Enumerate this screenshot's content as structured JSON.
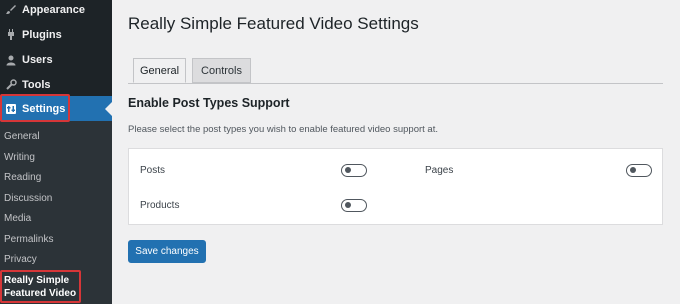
{
  "sidebar": {
    "menu": [
      {
        "label": "Appearance",
        "icon": "paintbrush-icon"
      },
      {
        "label": "Plugins",
        "icon": "plug-icon"
      },
      {
        "label": "Users",
        "icon": "user-icon"
      },
      {
        "label": "Tools",
        "icon": "wrench-icon"
      },
      {
        "label": "Settings",
        "icon": "settings-icon"
      }
    ],
    "submenu": [
      "General",
      "Writing",
      "Reading",
      "Discussion",
      "Media",
      "Permalinks",
      "Privacy"
    ],
    "submenu_current": {
      "line1": "Really Simple",
      "line2": "Featured Video"
    }
  },
  "page": {
    "title": "Really Simple Featured Video Settings",
    "tabs": [
      "General",
      "Controls"
    ],
    "active_tab": "General",
    "section_title": "Enable Post Types Support",
    "section_desc": "Please select the post types you wish to enable featured video support at.",
    "post_types": [
      {
        "label": "Posts",
        "enabled": false
      },
      {
        "label": "Pages",
        "enabled": false
      },
      {
        "label": "Products",
        "enabled": false
      }
    ],
    "save_label": "Save changes"
  },
  "colors": {
    "sidebar_bg": "#1d2327",
    "submenu_bg": "#2c3338",
    "accent": "#2271b1",
    "highlight_box": "#d63638",
    "page_bg": "#f0f0f1"
  }
}
